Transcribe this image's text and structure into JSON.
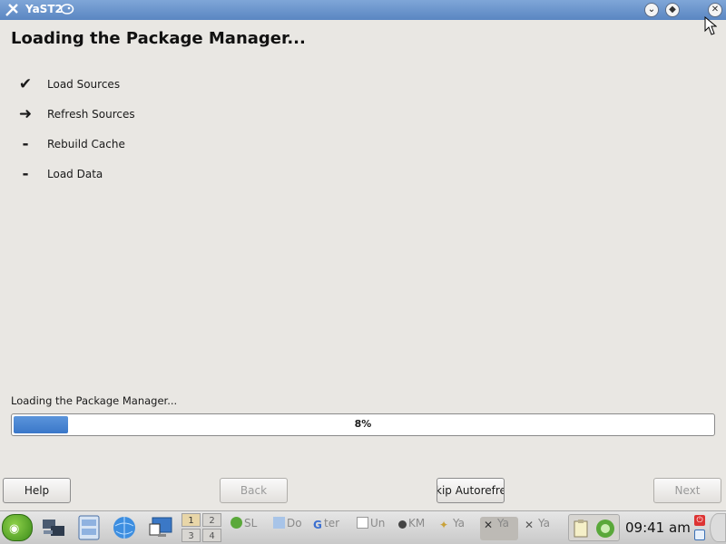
{
  "window": {
    "title": "YaST2"
  },
  "heading": "Loading the Package Manager...",
  "steps": [
    {
      "mark": "✔",
      "label": "Load Sources"
    },
    {
      "mark": "➜",
      "label": "Refresh Sources"
    },
    {
      "mark": "-",
      "label": "Rebuild Cache"
    },
    {
      "mark": "-",
      "label": "Load Data"
    }
  ],
  "progress": {
    "label": "Loading the Package Manager...",
    "value_percent": 8,
    "text": "8%"
  },
  "buttons": {
    "help": "Help",
    "back": "Back",
    "skip": "kip Autorefres",
    "next": "Next"
  },
  "taskbar": {
    "pager": [
      "1",
      "2",
      "3",
      "4"
    ],
    "active_desktop": "1",
    "tasks": [
      {
        "label": "SL",
        "icon": "suse-icon"
      },
      {
        "label": "Do",
        "icon": "document-icon"
      },
      {
        "label": "ter",
        "icon": "google-icon"
      },
      {
        "label": "Un",
        "icon": "text-file-icon"
      },
      {
        "label": "KM",
        "icon": "kmix-icon"
      },
      {
        "label": "Ya",
        "icon": "wand-icon"
      },
      {
        "label": "Ya",
        "icon": "yast-icon"
      },
      {
        "label": "Ya",
        "icon": "yast-icon"
      }
    ],
    "clock": "09:41 am"
  },
  "colors": {
    "titlebar": "#6a93cc",
    "progress_fill": "#4a86d1",
    "background": "#e9e7e3"
  }
}
